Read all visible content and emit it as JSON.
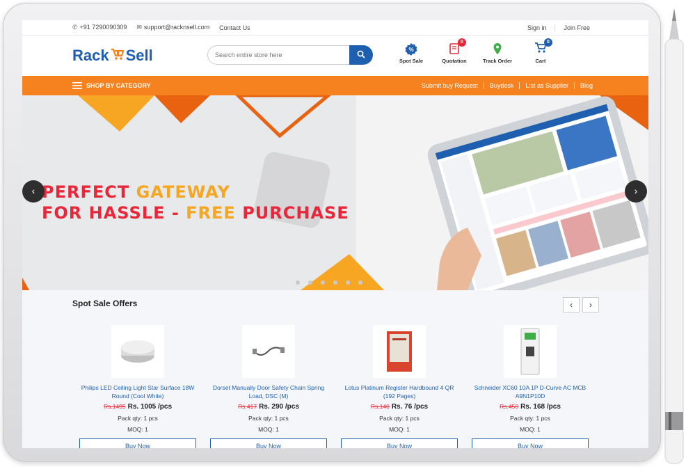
{
  "topbar": {
    "phone": "+91 7290090309",
    "email": "support@racknsell.com",
    "contact": "Contact Us",
    "sign_in": "Sign in",
    "join": "Join Free"
  },
  "header": {
    "logo_left": "Rack",
    "logo_right": "Sell",
    "search_placeholder": "Search entire store here",
    "icons": [
      {
        "label": "Spot Sale",
        "icon": "spot-sale-icon",
        "badge": ""
      },
      {
        "label": "Quotation",
        "icon": "quotation-icon",
        "badge": "0"
      },
      {
        "label": "Track Order",
        "icon": "location-pin-icon",
        "badge": ""
      },
      {
        "label": "Cart",
        "icon": "cart-icon",
        "badge": "0"
      }
    ],
    "colors": {
      "brand": "#1f5fb0",
      "accent": "#f5821f",
      "quotation_badge": "#e8283a",
      "cart_badge": "#1f5fb0"
    }
  },
  "nav": {
    "category": "SHOP BY CATEGORY",
    "links": [
      "Submit buy Request",
      "Buydesk",
      "List as Supplier",
      "Blog"
    ]
  },
  "banner": {
    "line1_a": "PERFECT",
    "line1_b": "GATEWAY",
    "line2_a": "FOR HASSLE -",
    "line2_b": "FREE",
    "line2_c": "PURCHASE",
    "prev": "‹",
    "next": "›"
  },
  "spot": {
    "title": "Spot Sale Offers",
    "prev": "‹",
    "next": "›",
    "products": [
      {
        "name": "Philips LED Ceiling Light Star Surface 18W Round (Cool White)",
        "old_price": "Rs.1495",
        "price": "Rs. 1005 /pcs",
        "pack": "Pack qty: 1 pcs",
        "moq": "MOQ: 1",
        "buy": "Buy Now"
      },
      {
        "name": "Dorset Manually Door Safety Chain Spring Load, DSC (M)",
        "old_price": "Rs.417",
        "price": "Rs. 290 /pcs",
        "pack": "Pack qty: 1 pcs",
        "moq": "MOQ: 1",
        "buy": "Buy Now"
      },
      {
        "name": "Lotus Platinum Register Hardbound 4 QR (192 Pages)",
        "old_price": "Rs.140",
        "price": "Rs. 76 /pcs",
        "pack": "Pack qty: 1 pcs",
        "moq": "MOQ: 1",
        "buy": "Buy Now"
      },
      {
        "name": "Schneider XC60 10A 1P D-Curve AC MCB A9N1P10D",
        "old_price": "Rs.450",
        "price": "Rs. 168 /pcs",
        "pack": "Pack qty: 1 pcs",
        "moq": "MOQ: 1",
        "buy": "Buy Now"
      }
    ]
  }
}
